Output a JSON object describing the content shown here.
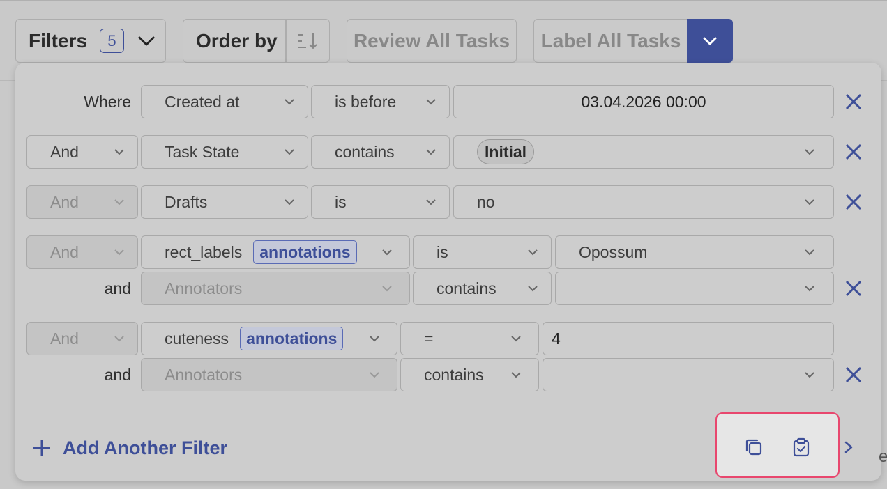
{
  "toolbar": {
    "filters_label": "Filters",
    "filters_count": "5",
    "order_by_label": "Order by",
    "review_label": "Review All Tasks",
    "label_all_label": "Label All Tasks"
  },
  "filters": [
    {
      "conjunction": "Where",
      "field": "Created at",
      "operator": "is before",
      "value": "03.04.2026 00:00"
    },
    {
      "conjunction": "And",
      "field": "Task State",
      "operator": "contains",
      "value": "Initial"
    },
    {
      "conjunction": "And",
      "field": "Drafts",
      "operator": "is",
      "value": "no"
    },
    {
      "conjunction": "And",
      "field": "rect_labels",
      "field_tag": "annotations",
      "operator": "is",
      "value": "Opossum",
      "sub": {
        "conjunction": "and",
        "field": "Annotators",
        "operator": "contains",
        "value": ""
      }
    },
    {
      "conjunction": "And",
      "field": "cuteness",
      "field_tag": "annotations",
      "operator": "=",
      "value": "4",
      "sub": {
        "conjunction": "and",
        "field": "Annotators",
        "operator": "contains",
        "value": ""
      }
    }
  ],
  "add_filter_label": "Add Another Filter",
  "actions": {
    "copy_icon": "copy-icon",
    "paste_icon": "clipboard-check-icon",
    "next_icon": "chevron-right-icon"
  },
  "edge_text": "e",
  "colors": {
    "accent": "#3e4f98",
    "highlight": "#e8476e",
    "background": "#c9c9c9"
  }
}
